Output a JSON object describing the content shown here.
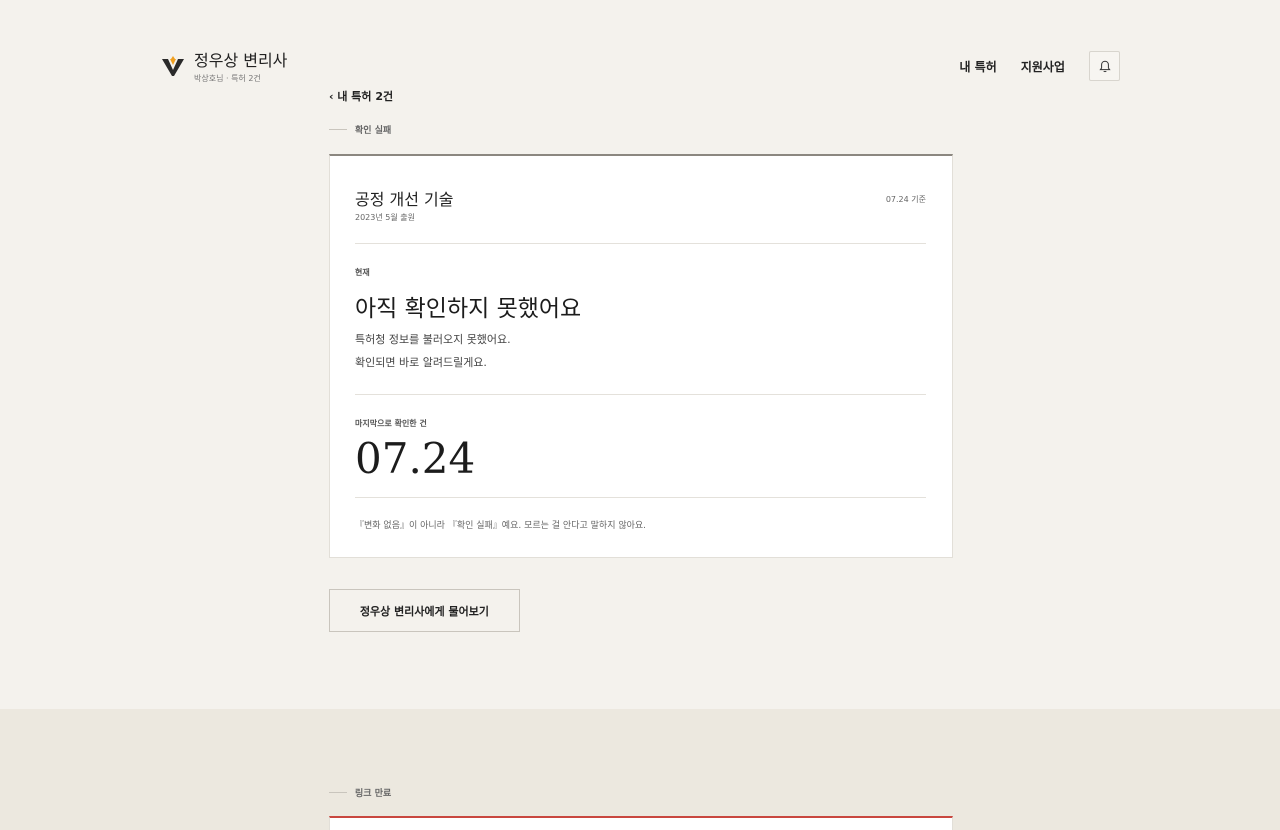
{
  "brand": {
    "name": "정우상 변리사",
    "subtitle": "박상호님 · 특허 2건"
  },
  "nav": {
    "items": [
      "내 특허",
      "지원사업"
    ]
  },
  "back": "‹ 내 특허 2건",
  "section1": {
    "label": "확인 실패"
  },
  "patent": {
    "title": "공정 개선 기술",
    "filed": "2023년 5월 출원",
    "as_of": "07.24 기준",
    "current_label": "현재",
    "status_title": "아직 확인하지 못했어요",
    "desc_line1": "특허청 정보를 불러오지 못했어요.",
    "desc_line2": "확인되면 바로 알려드릴게요.",
    "last_checked_label": "마지막으로 확인한 건",
    "last_checked_date": "07.24",
    "note": "『변화 없음』이 아니라 『확인 실패』예요. 모르는 걸 안다고 말하지 않아요."
  },
  "ask_button": "정우상 변리사에게 물어보기",
  "section2": {
    "label": "링크 만료"
  },
  "colors": {
    "accent": "#f0a020",
    "logo_dark": "#2a2a2a",
    "alert_red": "#c9473f"
  }
}
